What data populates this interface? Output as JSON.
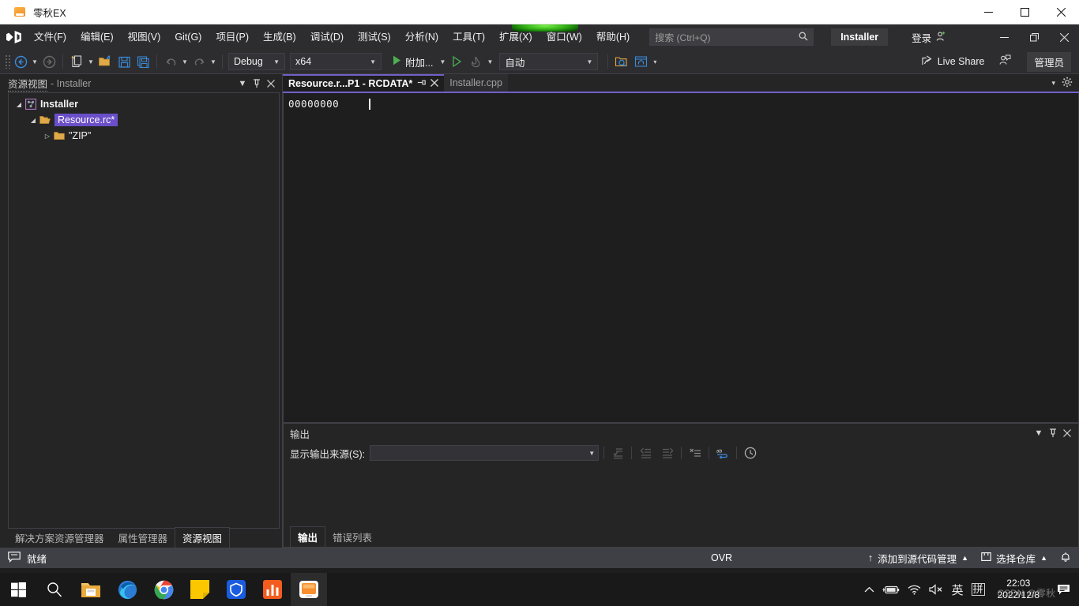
{
  "window": {
    "title": "零秋EX",
    "icon": "app-window-icon",
    "minimize": "—",
    "maximize": "□",
    "close": "✕"
  },
  "menubar": {
    "logo": "visual-studio-logo",
    "items": [
      {
        "label": "文件(F)"
      },
      {
        "label": "编辑(E)"
      },
      {
        "label": "视图(V)"
      },
      {
        "label": "Git(G)"
      },
      {
        "label": "项目(P)"
      },
      {
        "label": "生成(B)"
      },
      {
        "label": "调试(D)"
      },
      {
        "label": "测试(S)"
      },
      {
        "label": "分析(N)"
      },
      {
        "label": "工具(T)"
      },
      {
        "label": "扩展(X)"
      },
      {
        "label": "窗口(W)"
      },
      {
        "label": "帮助(H)"
      }
    ],
    "search_placeholder": "搜索 (Ctrl+Q)",
    "search_value": "",
    "project_chip": "Installer",
    "sign_in": "登录",
    "win_min": "—",
    "win_max": "❐",
    "win_close": "✕"
  },
  "toolbar": {
    "nav_back": "back-arrow",
    "nav_forward": "forward-arrow",
    "new_item": "new-item",
    "open_file": "open-file",
    "save": "save",
    "save_all": "save-all",
    "undo": "undo",
    "redo": "redo",
    "config": {
      "value": "Debug",
      "caret": "▾"
    },
    "platform": {
      "value": "x64",
      "caret": "▾"
    },
    "attach_label": "附加...",
    "attach_caret": "▾",
    "hot_reload_caret": "▾",
    "auto_select": {
      "value": "自动",
      "caret": "▾"
    },
    "live_share": "Live Share",
    "admin_chip": "管理员"
  },
  "resource_view": {
    "title": "资源视图",
    "subtitle": "- Installer",
    "header_dropdown": "▾",
    "header_pin": "⊥",
    "header_close": "✕",
    "tree": [
      {
        "expander": "◢",
        "icon": "project-icon",
        "label": "Installer",
        "bold": true,
        "selected": false,
        "indent": 0
      },
      {
        "expander": "◢",
        "icon": "folder-open-icon",
        "label": "Resource.rc*",
        "bold": false,
        "selected": true,
        "indent": 1
      },
      {
        "expander": "▷",
        "icon": "folder-icon",
        "label": "\"ZIP\"",
        "bold": false,
        "selected": false,
        "indent": 2
      }
    ],
    "dock_tabs": [
      {
        "label": "解决方案资源管理器",
        "active": false
      },
      {
        "label": "属性管理器",
        "active": false
      },
      {
        "label": "资源视图",
        "active": true
      }
    ]
  },
  "editor": {
    "tabs": [
      {
        "label": "Resource.r...P1 - RCDATA*",
        "active": true,
        "pin": "⇥",
        "close": "✕"
      },
      {
        "label": "Installer.cpp",
        "active": false
      }
    ],
    "strip_dropdown": "▾",
    "strip_gear": "⚙",
    "content_line": "00000000",
    "accent_color": "#7160c8"
  },
  "output": {
    "title": "输出",
    "head_dropdown": "▾",
    "head_pin": "⊥",
    "head_close": "✕",
    "source_label": "显示输出来源(S):",
    "source_value": "",
    "source_caret": "▾",
    "toolbar_icons": [
      "goto-message-icon",
      "previous-message-icon",
      "next-message-icon",
      "clear-all-icon",
      "toggle-word-wrap-icon",
      "show-timestamps-icon"
    ],
    "tabs": [
      {
        "label": "输出",
        "active": true
      },
      {
        "label": "错误列表",
        "active": false
      }
    ]
  },
  "statusbar": {
    "icon": "ready-icon",
    "ready": "就绪",
    "ovr": "OVR",
    "source_control": {
      "icon": "↑",
      "label": "添加到源代码管理",
      "caret": "▲"
    },
    "repository": {
      "icon": "⊓",
      "label": "选择仓库",
      "caret": "▲"
    },
    "notifications": "🔔"
  },
  "taskbar": {
    "items": [
      {
        "name": "start-button",
        "icon": "windows-logo"
      },
      {
        "name": "search-button",
        "icon": "search"
      },
      {
        "name": "file-explorer",
        "icon": "folder"
      },
      {
        "name": "microsoft-edge",
        "icon": "edge"
      },
      {
        "name": "google-chrome",
        "icon": "chrome"
      },
      {
        "name": "sticky-notes",
        "icon": "note"
      },
      {
        "name": "security-shield",
        "icon": "shield"
      },
      {
        "name": "chart-app",
        "icon": "bars"
      },
      {
        "name": "visual-studio",
        "icon": "vs-window",
        "active": true
      }
    ],
    "tray": {
      "chevron": "︿",
      "battery": "battery-icon",
      "network": "wifi-icon",
      "volume": "volume-muted-icon",
      "ime_lang": "英",
      "ime_mode": "拼",
      "time": "22:03",
      "date": "2022/12/8",
      "action_center": "notification-icon"
    },
    "watermark": "CSDN @零秋"
  }
}
